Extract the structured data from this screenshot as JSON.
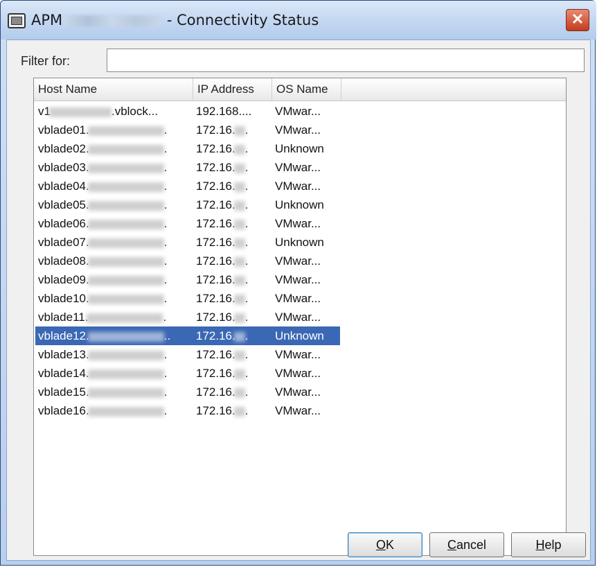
{
  "window": {
    "title_prefix": "APM",
    "title_suffix": " - Connectivity Status",
    "close_label": "✕"
  },
  "filter": {
    "label": "Filter for:",
    "value": "",
    "placeholder": ""
  },
  "table": {
    "columns": [
      "Host Name",
      "IP Address",
      "OS Name"
    ],
    "rows": [
      {
        "host": "v1",
        "host_tail": ".vblock...",
        "ip": "192.168....",
        "ip_blur": false,
        "os": "VMwar..."
      },
      {
        "host": "vblade01.",
        "host_tail": ".",
        "ip": "172.16.",
        "ip_tail": ".",
        "ip_blur": true,
        "os": "VMwar..."
      },
      {
        "host": "vblade02.",
        "host_tail": ".",
        "ip": "172.16.",
        "ip_tail": ".",
        "ip_blur": true,
        "os": "Unknown"
      },
      {
        "host": "vblade03.",
        "host_tail": ".",
        "ip": "172.16.",
        "ip_tail": ".",
        "ip_blur": true,
        "os": "VMwar..."
      },
      {
        "host": "vblade04.",
        "host_tail": ".",
        "ip": "172.16.",
        "ip_tail": ".",
        "ip_blur": true,
        "os": "VMwar..."
      },
      {
        "host": "vblade05.",
        "host_tail": ".",
        "ip": "172.16.",
        "ip_tail": ".",
        "ip_blur": true,
        "os": "Unknown"
      },
      {
        "host": "vblade06.",
        "host_tail": ".",
        "ip": "172.16.",
        "ip_tail": ".",
        "ip_blur": true,
        "os": "VMwar..."
      },
      {
        "host": "vblade07.",
        "host_tail": ".",
        "ip": "172.16.",
        "ip_tail": ".",
        "ip_blur": true,
        "os": "Unknown"
      },
      {
        "host": "vblade08.",
        "host_tail": ".",
        "ip": "172.16.",
        "ip_tail": ".",
        "ip_blur": true,
        "os": "VMwar..."
      },
      {
        "host": "vblade09.",
        "host_tail": ".",
        "ip": "172.16.",
        "ip_tail": ".",
        "ip_blur": true,
        "os": "VMwar..."
      },
      {
        "host": "vblade10.",
        "host_tail": ".",
        "ip": "172.16.",
        "ip_tail": ".",
        "ip_blur": true,
        "os": "VMwar..."
      },
      {
        "host": "vblade11.",
        "host_tail": ".",
        "ip": "172.16.",
        "ip_tail": ".",
        "ip_blur": true,
        "os": "VMwar..."
      },
      {
        "host": "vblade12.",
        "host_tail": "..",
        "ip": "172.16.",
        "ip_tail": ".",
        "ip_blur": true,
        "os": "Unknown",
        "selected": true
      },
      {
        "host": "vblade13.",
        "host_tail": ".",
        "ip": "172.16.",
        "ip_tail": ".",
        "ip_blur": true,
        "os": "VMwar..."
      },
      {
        "host": "vblade14.",
        "host_tail": ".",
        "ip": "172.16.",
        "ip_tail": ".",
        "ip_blur": true,
        "os": "VMwar..."
      },
      {
        "host": "vblade15.",
        "host_tail": ".",
        "ip": "172.16.",
        "ip_tail": ".",
        "ip_blur": true,
        "os": "VMwar..."
      },
      {
        "host": "vblade16.",
        "host_tail": ".",
        "ip": "172.16.",
        "ip_tail": ".",
        "ip_blur": true,
        "os": "VMwar..."
      }
    ]
  },
  "buttons": {
    "ok": {
      "mnemonic": "O",
      "rest": "K"
    },
    "cancel": {
      "mnemonic": "C",
      "rest": "ancel"
    },
    "help": {
      "mnemonic": "H",
      "rest": "elp"
    }
  },
  "colors": {
    "selection": "#3b68b5",
    "title_bar": "#c4d8f2",
    "close_button": "#c43b1c"
  },
  "icons": {
    "app": "app-window-icon",
    "close": "close-icon"
  }
}
